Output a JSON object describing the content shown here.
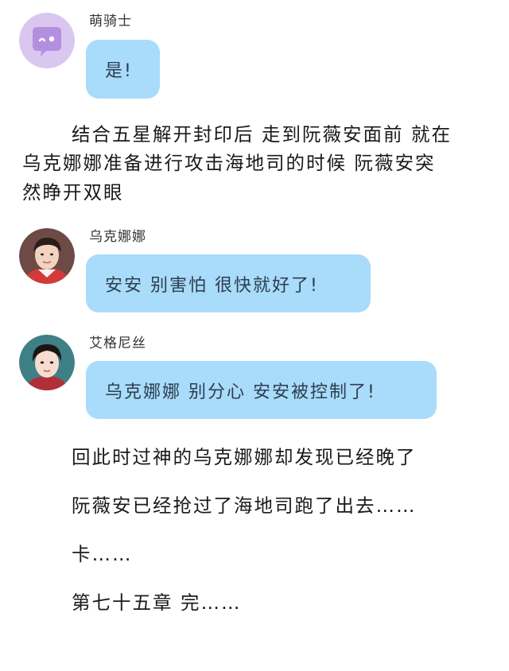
{
  "messages": [
    {
      "name": "萌骑士",
      "text": "是!"
    },
    {
      "name": "乌克娜娜",
      "text": "安安 别害怕 很快就好了!"
    },
    {
      "name": "艾格尼丝",
      "text": "乌克娜娜 别分心 安安被控制了!"
    }
  ],
  "narration": {
    "para1": [
      "结合五星解开封印后 走到阮薇安面前 就在",
      "乌克娜娜准备进行攻击海地司的时候 阮薇安突",
      "然睁开双眼"
    ],
    "lines": [
      "回此时过神的乌克娜娜却发现已经晚了",
      "阮薇安已经抢过了海地司跑了出去……",
      "卡……",
      "第七十五章 完……"
    ]
  },
  "colors": {
    "bubble": "#a9dbfa",
    "cartoon_avatar_bg": "#d9c7f0",
    "cartoon_avatar_fg": "#b48fe0"
  }
}
